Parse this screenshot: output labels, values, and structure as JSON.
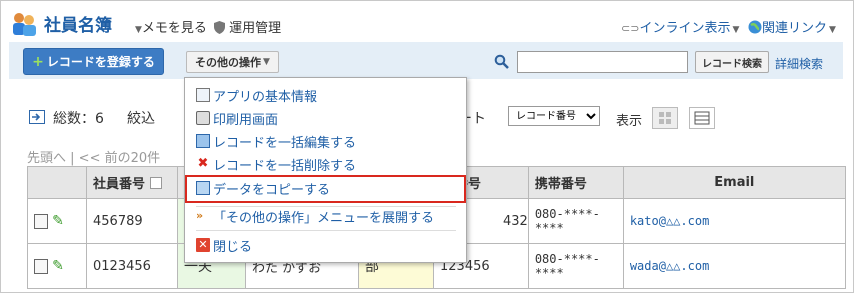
{
  "app": {
    "title": "社員名簿",
    "memo_link": "メモを見る",
    "manage_link": "運用管理",
    "inline_link": "インライン表示",
    "related_link": "関連リンク"
  },
  "toolbar": {
    "register_label": "レコードを登録する",
    "other_ops_label": "その他の操作",
    "search_value": "",
    "search_button": "レコード検索",
    "adv_search": "詳細検索"
  },
  "controls": {
    "total": "総数：6",
    "filter": "絞込",
    "sort_label_tail": "ート",
    "sort_selected": "レコード番号",
    "display_label": "表示",
    "pager_first": "先頭へ",
    "pager_prev": "<< 前の20件"
  },
  "menu": {
    "items": [
      {
        "label": "アプリの基本情報",
        "icon": "app-info-icon"
      },
      {
        "label": "印刷用画面",
        "icon": "printer-icon"
      },
      {
        "label": "レコードを一括編集する",
        "icon": "bulk-edit-icon"
      },
      {
        "label": "レコードを一括削除する",
        "icon": "red-x-icon"
      },
      {
        "label": "データをコピーする",
        "icon": "copy-data-icon"
      },
      {
        "label": "「その他の操作」メニューを展開する",
        "icon": "expand-menu-icon"
      },
      {
        "label": "閉じる",
        "icon": "close-icon"
      }
    ]
  },
  "table": {
    "headers": {
      "emp_no": "社員番号",
      "phone_tail": "線番号",
      "mobile": "携帯番号",
      "email": "Email"
    },
    "rows": [
      {
        "emp_no": "456789",
        "name_frag": "",
        "kana_frag": "",
        "dept_frag": "",
        "phone": "432",
        "mobile_1": "080-****-",
        "mobile_2": "****",
        "email": "kato@△△.com"
      },
      {
        "emp_no": "0123456",
        "name_frag": "一夫",
        "kana_frag": "わた かずお",
        "dept_frag": "部",
        "phone": "123456",
        "mobile_1": "080-****-",
        "mobile_2": "****",
        "email": "wada@△△.com"
      }
    ]
  },
  "colors": {
    "accent": "#1f5fa6",
    "toolbar_bg": "#e4eef7",
    "register_button": "#3d7cc4",
    "highlight": "#d9281e"
  }
}
